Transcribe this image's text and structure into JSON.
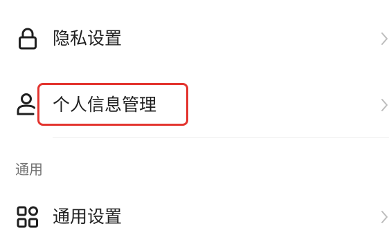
{
  "settings": {
    "privacy_row": {
      "label": "隐私设置",
      "icon": "lock-icon"
    },
    "personal_info_row": {
      "label": "个人信息管理",
      "icon": "person-icon",
      "highlighted": true,
      "highlight_color": "#e3342f"
    },
    "general_section": {
      "header": "通用"
    },
    "general_settings_row": {
      "label": "通用设置",
      "icon": "grid-icon"
    },
    "chevron_icon": "chevron-right-icon"
  }
}
